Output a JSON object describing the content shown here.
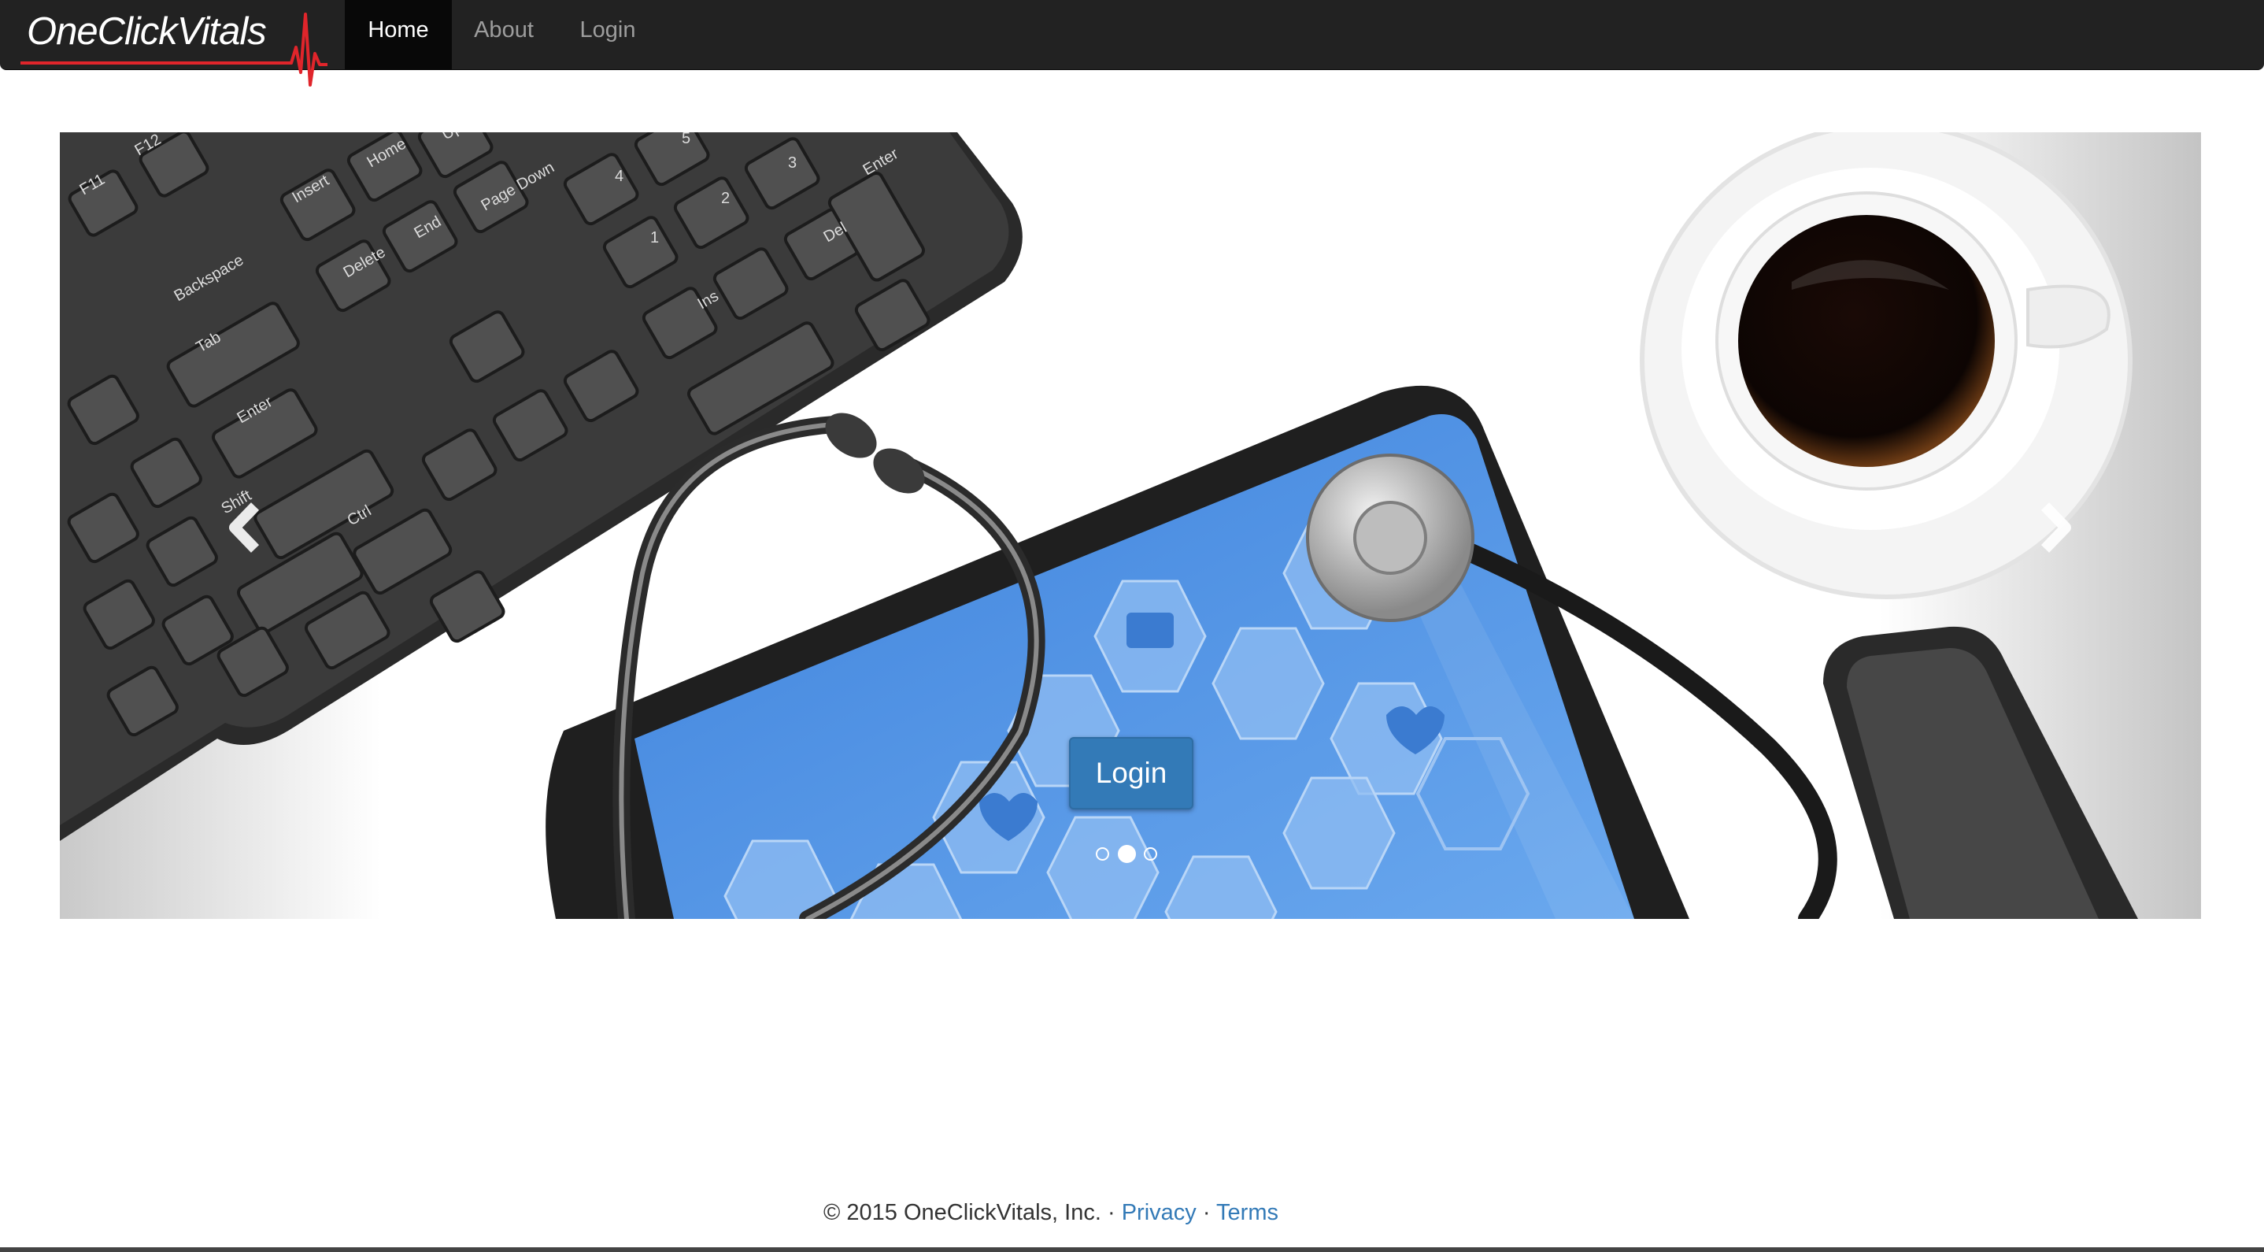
{
  "brand": {
    "name": "OneClickVitals"
  },
  "nav": {
    "items": [
      {
        "label": "Home",
        "active": true
      },
      {
        "label": "About",
        "active": false
      },
      {
        "label": "Login",
        "active": false
      }
    ]
  },
  "carousel": {
    "cta_label": "Login",
    "prev_icon": "chevron-left-icon",
    "next_icon": "chevron-right-icon",
    "slide_count": 3,
    "active_slide": 2,
    "keyboard_keys": [
      "F11",
      "F12",
      "Insert",
      "Home",
      "Up",
      "Page Down",
      "Delete",
      "End",
      "Backspace",
      "Tab",
      "Enter",
      "Shift",
      "Ctrl",
      "Ins",
      "Del",
      "Enter",
      "1",
      "2",
      "3",
      "4",
      "5"
    ]
  },
  "footer": {
    "copyright": "© 2015 OneClickVitals, Inc.",
    "separator": "·",
    "privacy_label": "Privacy",
    "terms_label": "Terms"
  },
  "colors": {
    "navbar": "#222222",
    "nav_active": "#080808",
    "accent": "#337ab7",
    "brand_pulse": "#e0252b",
    "tablet_screen": "#4a8ce0"
  }
}
